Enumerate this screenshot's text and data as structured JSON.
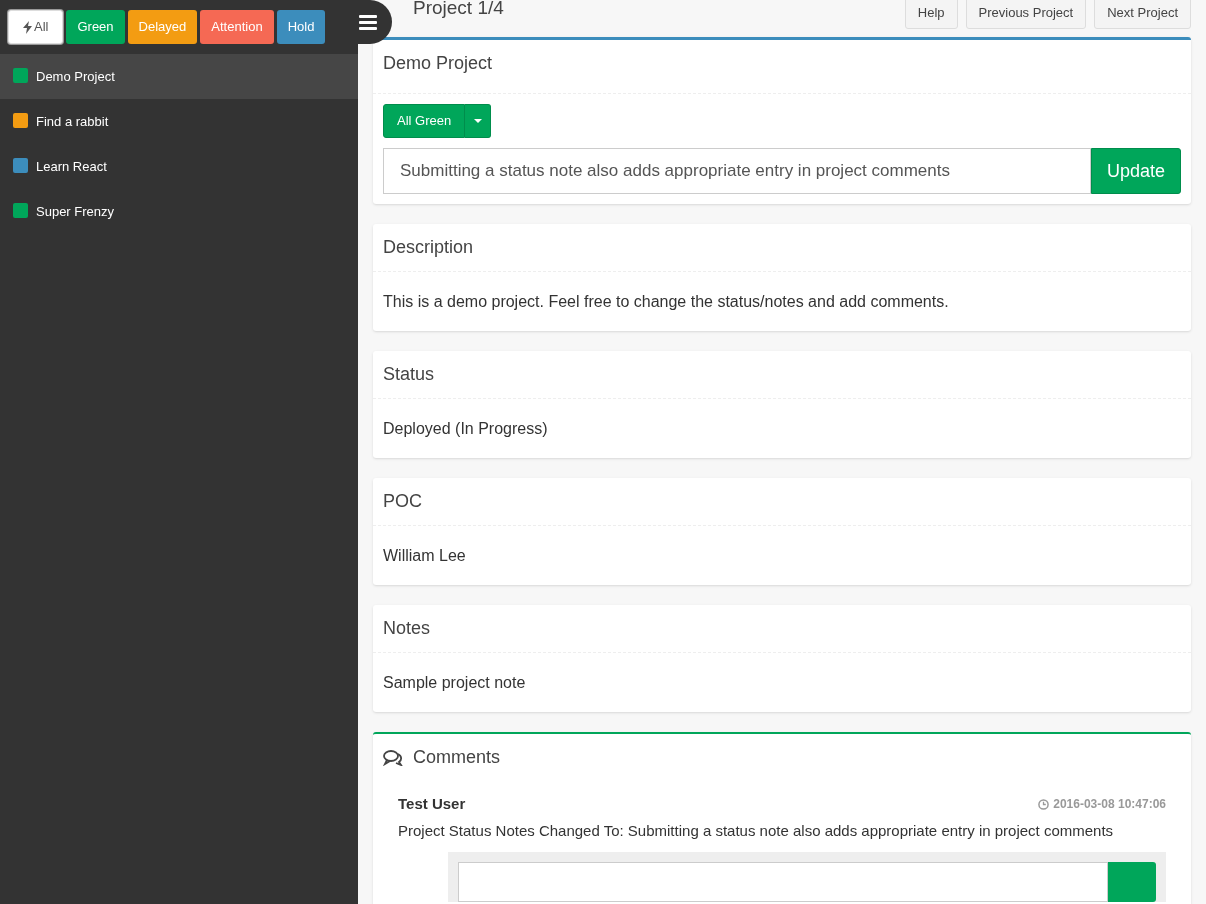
{
  "filters": [
    {
      "label": "All",
      "kind": "all",
      "color": "#ffffff",
      "selected": true
    },
    {
      "label": "Green",
      "kind": "status",
      "color": "#00a65a",
      "selected": false
    },
    {
      "label": "Delayed",
      "kind": "status",
      "color": "#f39c12",
      "selected": false
    },
    {
      "label": "Attention",
      "kind": "status",
      "color": "#f56954",
      "selected": false
    },
    {
      "label": "Hold",
      "kind": "status",
      "color": "#3c8dbc",
      "selected": false
    }
  ],
  "projects": [
    {
      "name": "Demo Project",
      "color": "#00a65a",
      "selected": true
    },
    {
      "name": "Find a rabbit",
      "color": "#f39c12",
      "selected": false
    },
    {
      "name": "Learn React",
      "color": "#3c8dbc",
      "selected": false
    },
    {
      "name": "Super Frenzy",
      "color": "#00a65a",
      "selected": false
    }
  ],
  "header": {
    "title": "Project 1/4",
    "buttons": [
      "Help",
      "Previous Project",
      "Next Project"
    ]
  },
  "project_panel": {
    "title": "Demo Project",
    "status_button": "All Green",
    "status_note": "Submitting a status note also adds appropriate entry in project comments",
    "update_button": "Update"
  },
  "sections": [
    {
      "title": "Description",
      "body": "This is a demo project. Feel free to change the status/notes and add comments."
    },
    {
      "title": "Status",
      "body": "Deployed (In Progress)"
    },
    {
      "title": "POC",
      "body": "William Lee"
    },
    {
      "title": "Notes",
      "body": "Sample project note"
    }
  ],
  "comments": {
    "title": "Comments",
    "items": [
      {
        "author": "Test User",
        "time": "2016-03-08 10:47:06",
        "text": "Project Status Notes Changed To: Submitting a status note also adds appropriate entry in project comments"
      }
    ]
  }
}
